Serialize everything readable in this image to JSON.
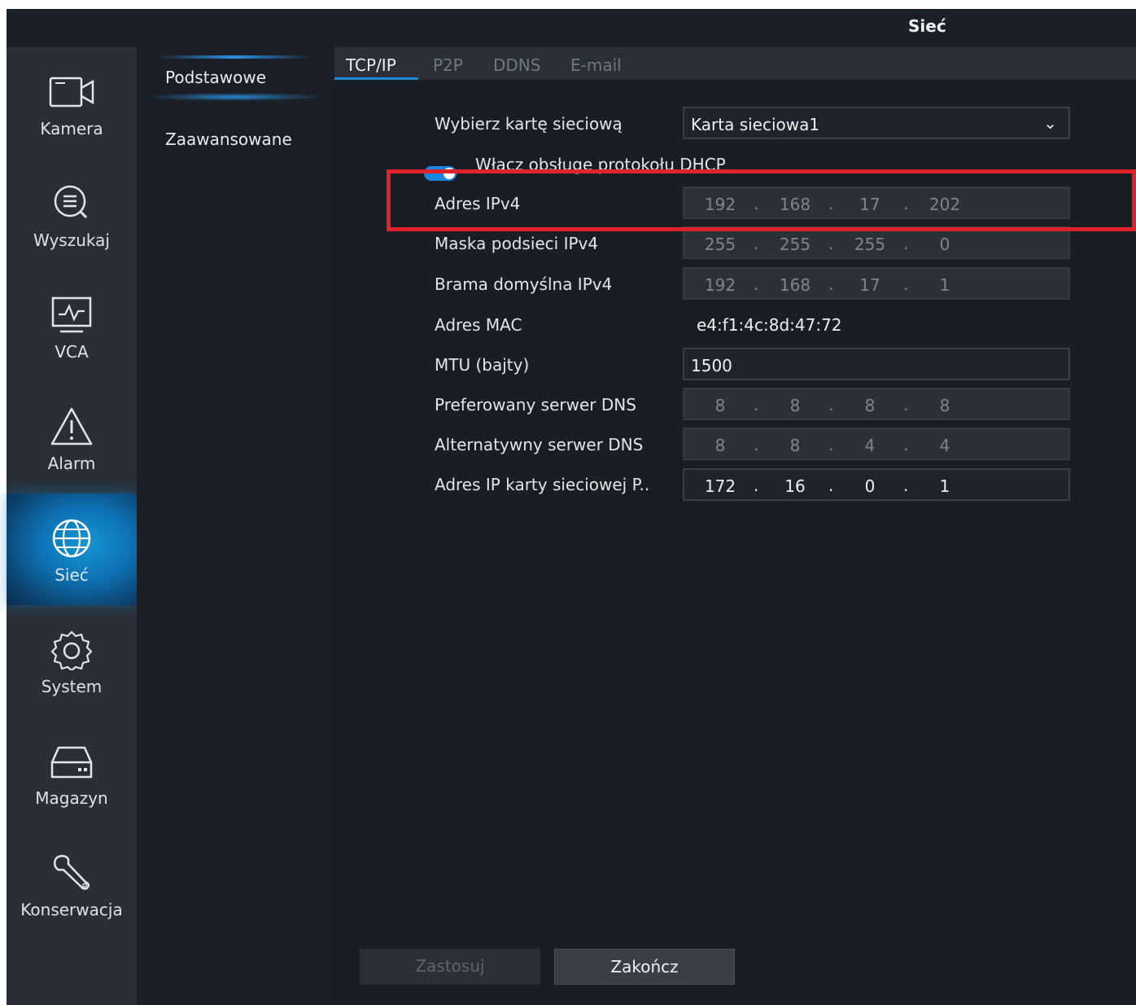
{
  "window": {
    "title": "Sieć"
  },
  "sidebar": {
    "items": [
      {
        "label": "Kamera",
        "icon": "camera-icon",
        "active": false
      },
      {
        "label": "Wyszukaj",
        "icon": "search-icon",
        "active": false
      },
      {
        "label": "VCA",
        "icon": "vca-monitor-icon",
        "active": false
      },
      {
        "label": "Alarm",
        "icon": "alarm-warning-icon",
        "active": false
      },
      {
        "label": "Sieć",
        "icon": "globe-icon",
        "active": true
      },
      {
        "label": "System",
        "icon": "gear-icon",
        "active": false
      },
      {
        "label": "Magazyn",
        "icon": "storage-drive-icon",
        "active": false
      },
      {
        "label": "Konserwacja",
        "icon": "wrench-icon",
        "active": false
      }
    ]
  },
  "subnav": {
    "items": [
      {
        "label": "Podstawowe",
        "active": true
      },
      {
        "label": "Zaawansowane",
        "active": false
      }
    ]
  },
  "tabs": [
    {
      "label": "TCP/IP",
      "active": true
    },
    {
      "label": "P2P",
      "active": false
    },
    {
      "label": "DDNS",
      "active": false
    },
    {
      "label": "E-mail",
      "active": false
    }
  ],
  "form": {
    "nic_label": "Wybierz kartę sieciową",
    "nic_value": "Karta sieciowa1",
    "dhcp_label": "Włącz obsługę protokołu DHCP",
    "dhcp_enabled": true,
    "ipv4_label": "Adres IPv4",
    "ipv4": [
      "192",
      "168",
      "17",
      "202"
    ],
    "mask_label": "Maska podsieci IPv4",
    "mask": [
      "255",
      "255",
      "255",
      "0"
    ],
    "gateway_label": "Brama domyślna IPv4",
    "gateway": [
      "192",
      "168",
      "17",
      "1"
    ],
    "mac_label": "Adres MAC",
    "mac_value": "e4:f1:4c:8d:47:72",
    "mtu_label": "MTU (bajty)",
    "mtu_value": "1500",
    "dns1_label": "Preferowany serwer DNS",
    "dns1": [
      "8",
      "8",
      "8",
      "8"
    ],
    "dns2_label": "Alternatywny serwer DNS",
    "dns2": [
      "8",
      "8",
      "4",
      "4"
    ],
    "poe_label": "Adres IP karty sieciowej P..",
    "poe": [
      "172",
      "16",
      "0",
      "1"
    ],
    "ip_separator": "."
  },
  "buttons": {
    "apply": "Zastosuj",
    "close": "Zakończ"
  },
  "colors": {
    "accent": "#1f8ad8",
    "highlight_box": "#e0202a"
  }
}
